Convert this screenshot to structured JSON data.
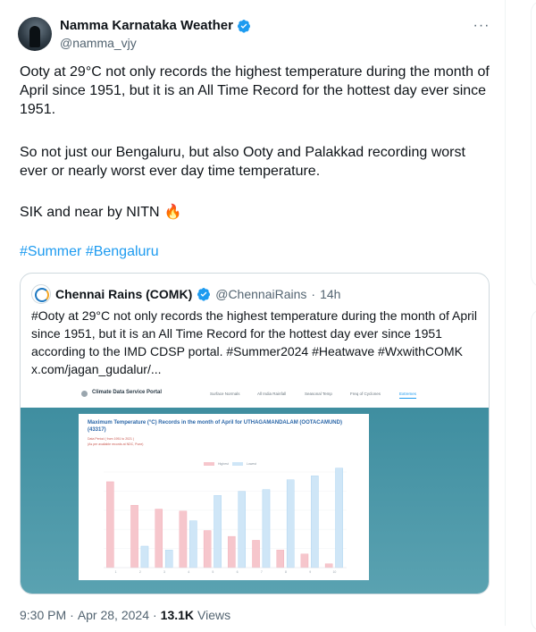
{
  "tweet": {
    "author_name": "Namma Karnataka Weather",
    "author_handle": "@namma_vjy",
    "more_label": "···",
    "para1": "Ooty at 29°C not only records the highest temperature during the month of April since 1951, but it is an All Time Record for the hottest day ever since 1951.",
    "para2": "So not just our Bengaluru, but also Ooty and Palakkad recording worst ever or nearly worst ever day time temperature.",
    "para3": "SIK and near by NITN",
    "emoji": "🔥",
    "hashtags": [
      "#Summer",
      "#Bengaluru"
    ],
    "time": "9:30 PM",
    "date": "Apr 28, 2024",
    "views_count": "13.1K",
    "views_label": "Views",
    "sep": "·"
  },
  "quote": {
    "author_name": "Chennai Rains (COMK)",
    "author_handle": "@ChennaiRains",
    "time": "14h",
    "sep": "·",
    "text": "#Ooty at 29°C not only records the highest temperature during the month of April since 1951, but it is an All Time Record for the hottest day ever since 1951 according to the IMD CDSP portal. #Summer2024 #Heatwave #WxwithCOMK x.com/jagan_gudalur/...",
    "image": {
      "portal_title": "Climate Data Service Portal",
      "nav": [
        "Surface Normals",
        "All India Rainfall",
        "Seasonal Temp",
        "Freq of Cyclones",
        "Extremes"
      ],
      "card_title": "Maximum Temperature (°C) Records in the month of April for UTHAGAMANDALAM (OOTACAMUND) (43317)",
      "card_sub": "Data Period ( from 1951 to 2021 )",
      "card_sub2": "(As per available records at NDC, Pune)",
      "legend": [
        "Highest",
        "Lowest"
      ]
    }
  },
  "colors": {
    "accent": "#1d9bf0",
    "muted": "#536471",
    "text": "#0f1419",
    "bar_pink": "#f6c6cc",
    "bar_blue": "#cfe6f7"
  },
  "chart_data": {
    "type": "bar",
    "categories": [
      "1",
      "2",
      "3",
      "4",
      "5",
      "6",
      "7",
      "8",
      "9",
      "10"
    ],
    "series": [
      {
        "name": "Highest",
        "values": [
          29.0,
          27.8,
          27.6,
          27.5,
          26.5,
          26.2,
          26.0,
          25.5,
          25.3,
          24.8
        ]
      },
      {
        "name": "Lowest",
        "values": [
          null,
          25.7,
          25.5,
          27.0,
          28.3,
          28.5,
          28.6,
          29.1,
          29.3,
          29.7
        ]
      }
    ],
    "ylim": [
      24.6,
      29.5
    ],
    "y2lim": [
      24.6,
      29.9
    ]
  }
}
